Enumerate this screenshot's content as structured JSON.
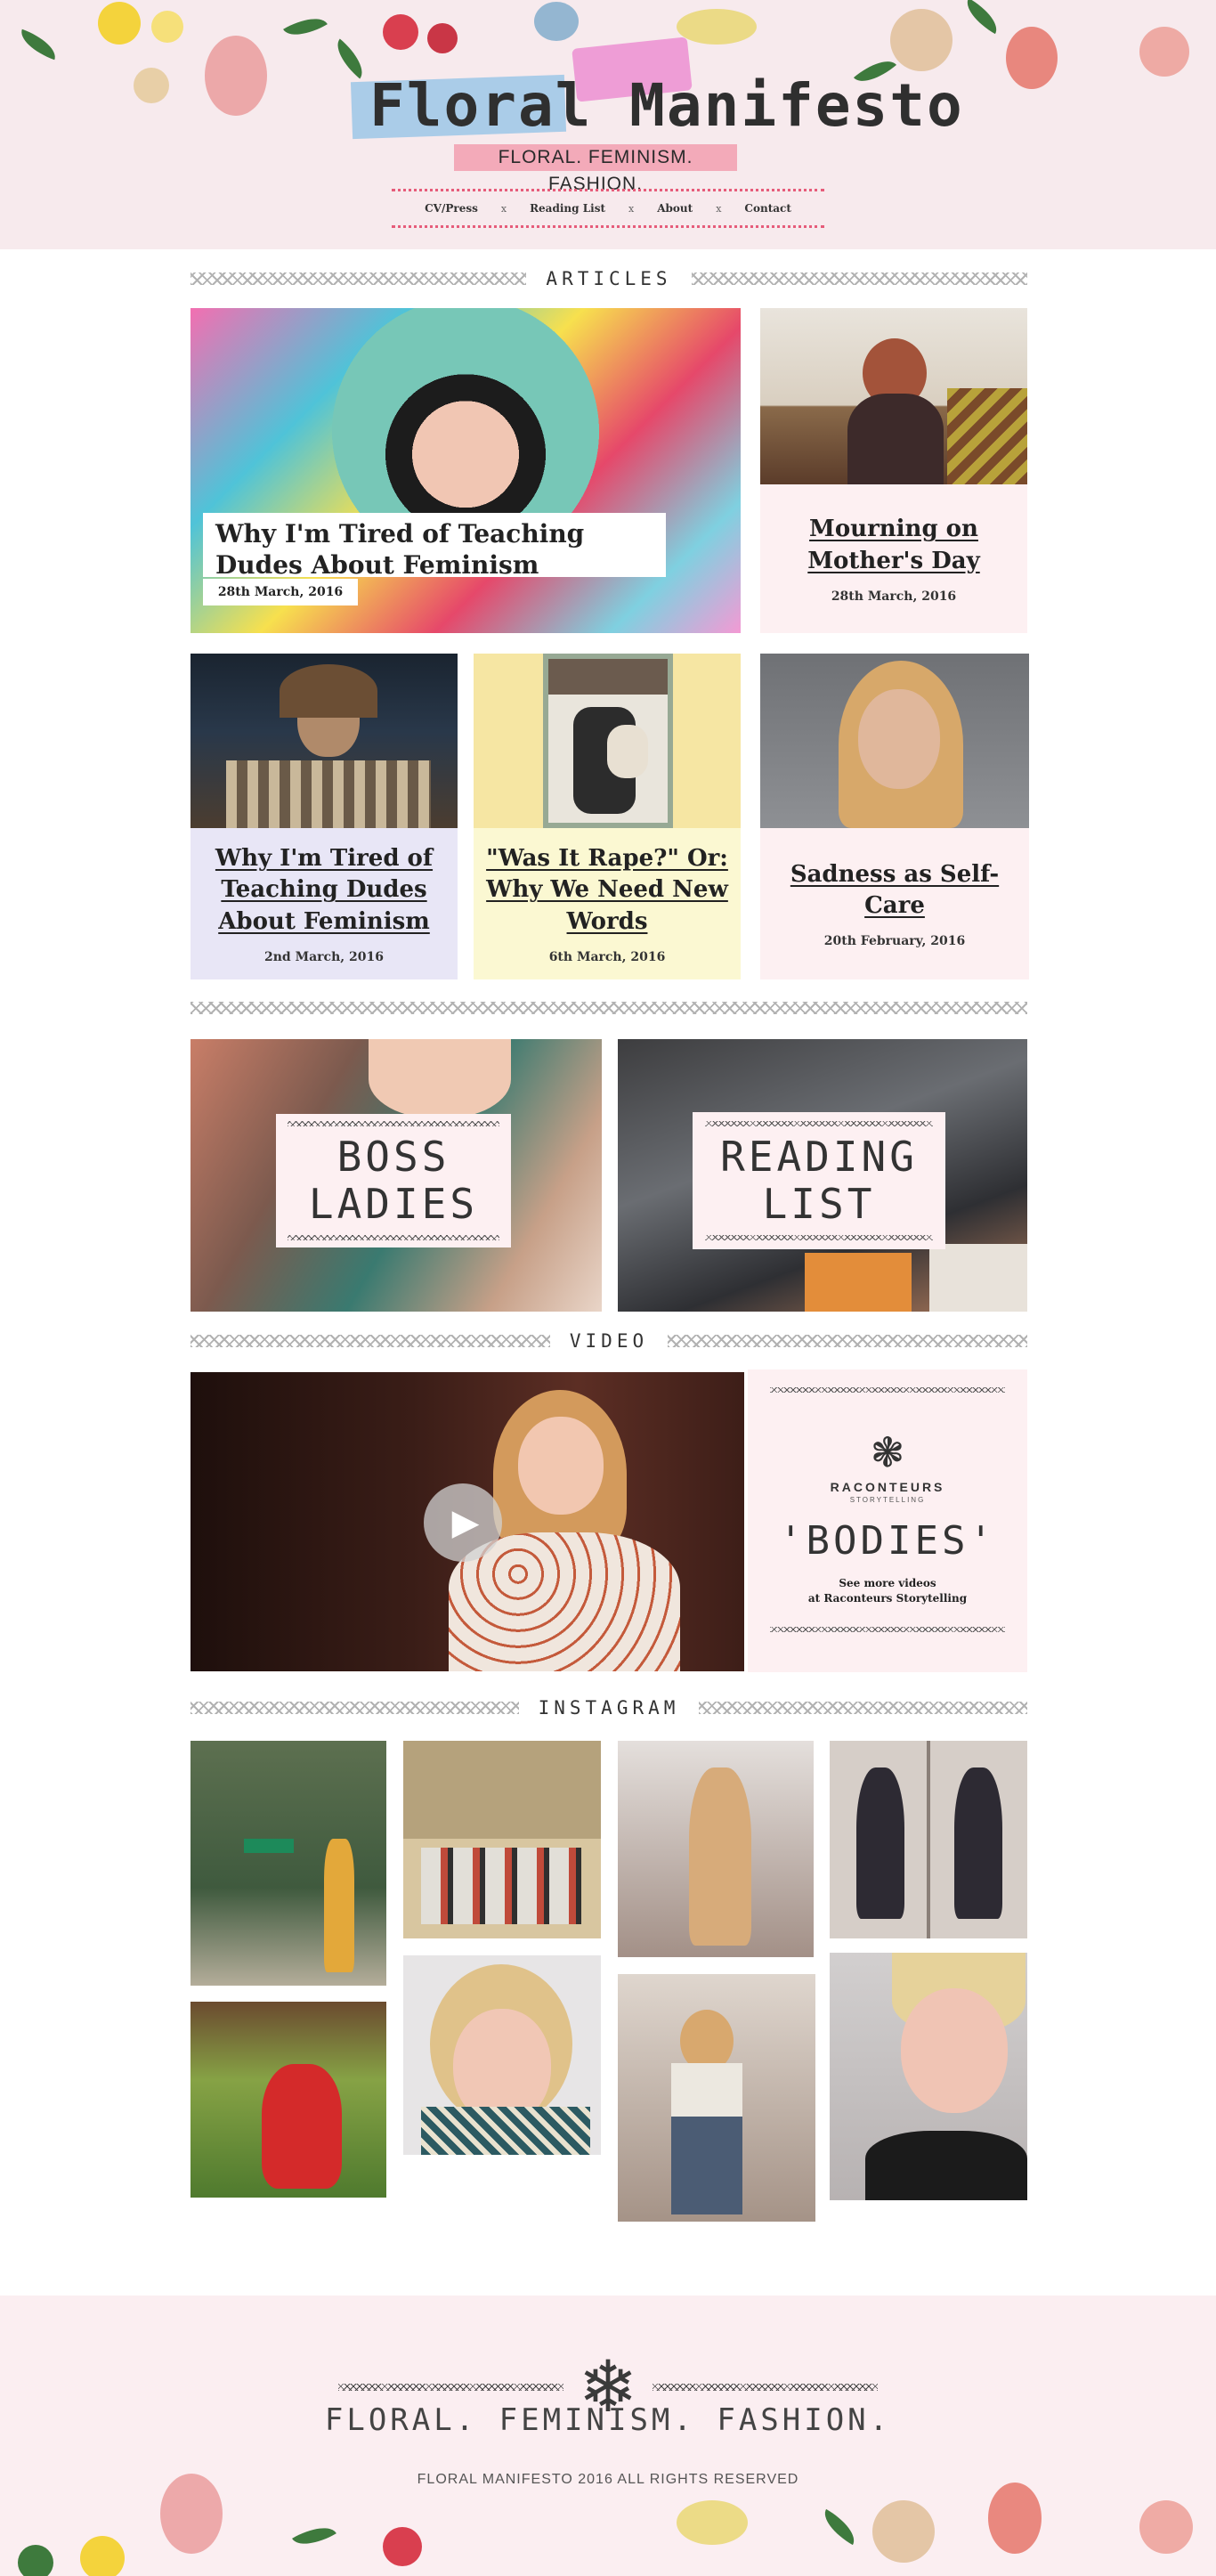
{
  "header": {
    "logo": "Floral Manifesto",
    "tagline": "FLORAL. FEMINISM. FASHION.",
    "nav": [
      "CV/Press",
      "Reading List",
      "About",
      "Contact"
    ],
    "nav_separator": "x"
  },
  "sections": {
    "articles": "ARTICLES",
    "video": "VIDEO",
    "instagram": "INSTAGRAM"
  },
  "articles": {
    "featured": {
      "title": "Why I'm Tired of Teaching Dudes About Feminism",
      "date": "28th March, 2016"
    },
    "mothers_day": {
      "title": "Mourning on Mother's Day",
      "date": "28th March, 2016"
    },
    "dudes": {
      "title": "Why I'm Tired of Teaching Dudes About Feminism",
      "date": "2nd March, 2016"
    },
    "rape": {
      "title": "\"Was It Rape?\" Or: Why We Need New Words",
      "date": "6th March, 2016"
    },
    "sadness": {
      "title": "Sadness as Self-Care",
      "date": "20th February, 2016"
    }
  },
  "banners": {
    "boss": "BOSS LADIES",
    "reading": "READING LIST"
  },
  "video": {
    "play_icon": "play-icon",
    "org_name": "RACONTEURS",
    "org_sub": "STORYTELLING",
    "title": "'BODIES'",
    "link_line1": "See more videos",
    "link_line2": "at Raconteurs Storytelling"
  },
  "footer": {
    "tagline": "FLORAL. FEMINISM. FASHION.",
    "copyright": "FLORAL MANIFESTO 2016 ALL RIGHTS RESERVED"
  },
  "colors": {
    "header_bg": "#f7eaed",
    "pink_card": "#fdf0f2",
    "lavender_card": "#e8e6f6",
    "yellow_card": "#fbf8d2",
    "nav_dots": "#e65c7a"
  }
}
